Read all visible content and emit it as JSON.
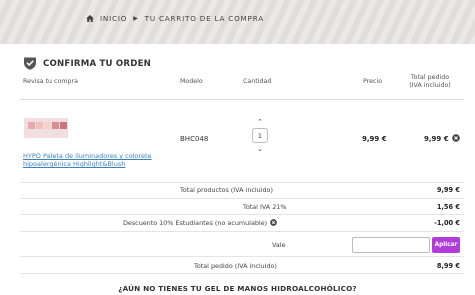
{
  "breadcrumb": {
    "home": "INICIO",
    "current": "TU CARRITO DE LA COMPRA"
  },
  "order": {
    "title": "CONFIRMA TU ORDEN",
    "headers": {
      "product": "Revisa tu compra",
      "model": "Modelo",
      "quantity": "Cantidad",
      "price": "Precio",
      "total_line1": "Total pedido",
      "total_line2": "(IVA incluido)"
    },
    "item": {
      "name": "HYPO Paleta de iluminadores y colorete hipoalergénica Highlight&Blush",
      "model": "BHC048",
      "quantity": "1",
      "price": "9,99 €",
      "total": "9,99 €"
    },
    "summary": {
      "subtotal_label": "Total productos (IVA incluido)",
      "subtotal_value": "9,99 €",
      "tax_label": "Total IVA 21%",
      "tax_value": "1,56 €",
      "discount_label": "Descuento 10% Estudiantes (no acumulable)",
      "discount_value": "-1,00 €",
      "voucher_label": "Vale",
      "voucher_value": "",
      "apply_label": "Aplicar",
      "grand_label": "Total pedido (IVA incluido)",
      "grand_value": "8,99 €"
    }
  },
  "promo": {
    "text": "¿AÚN NO TIENES TU GEL DE MANOS HIDROALCOHÓLICO?"
  },
  "colors": {
    "link": "#3a7fc0",
    "accent": "#b03ddb",
    "banner": "#e4e1df"
  },
  "icons": {
    "home": "home-icon",
    "separator": "chevron-right-icon",
    "confirm": "shield-check-icon",
    "remove": "remove-icon",
    "qty_up": "chevron-up-icon",
    "qty_down": "chevron-down-icon"
  }
}
